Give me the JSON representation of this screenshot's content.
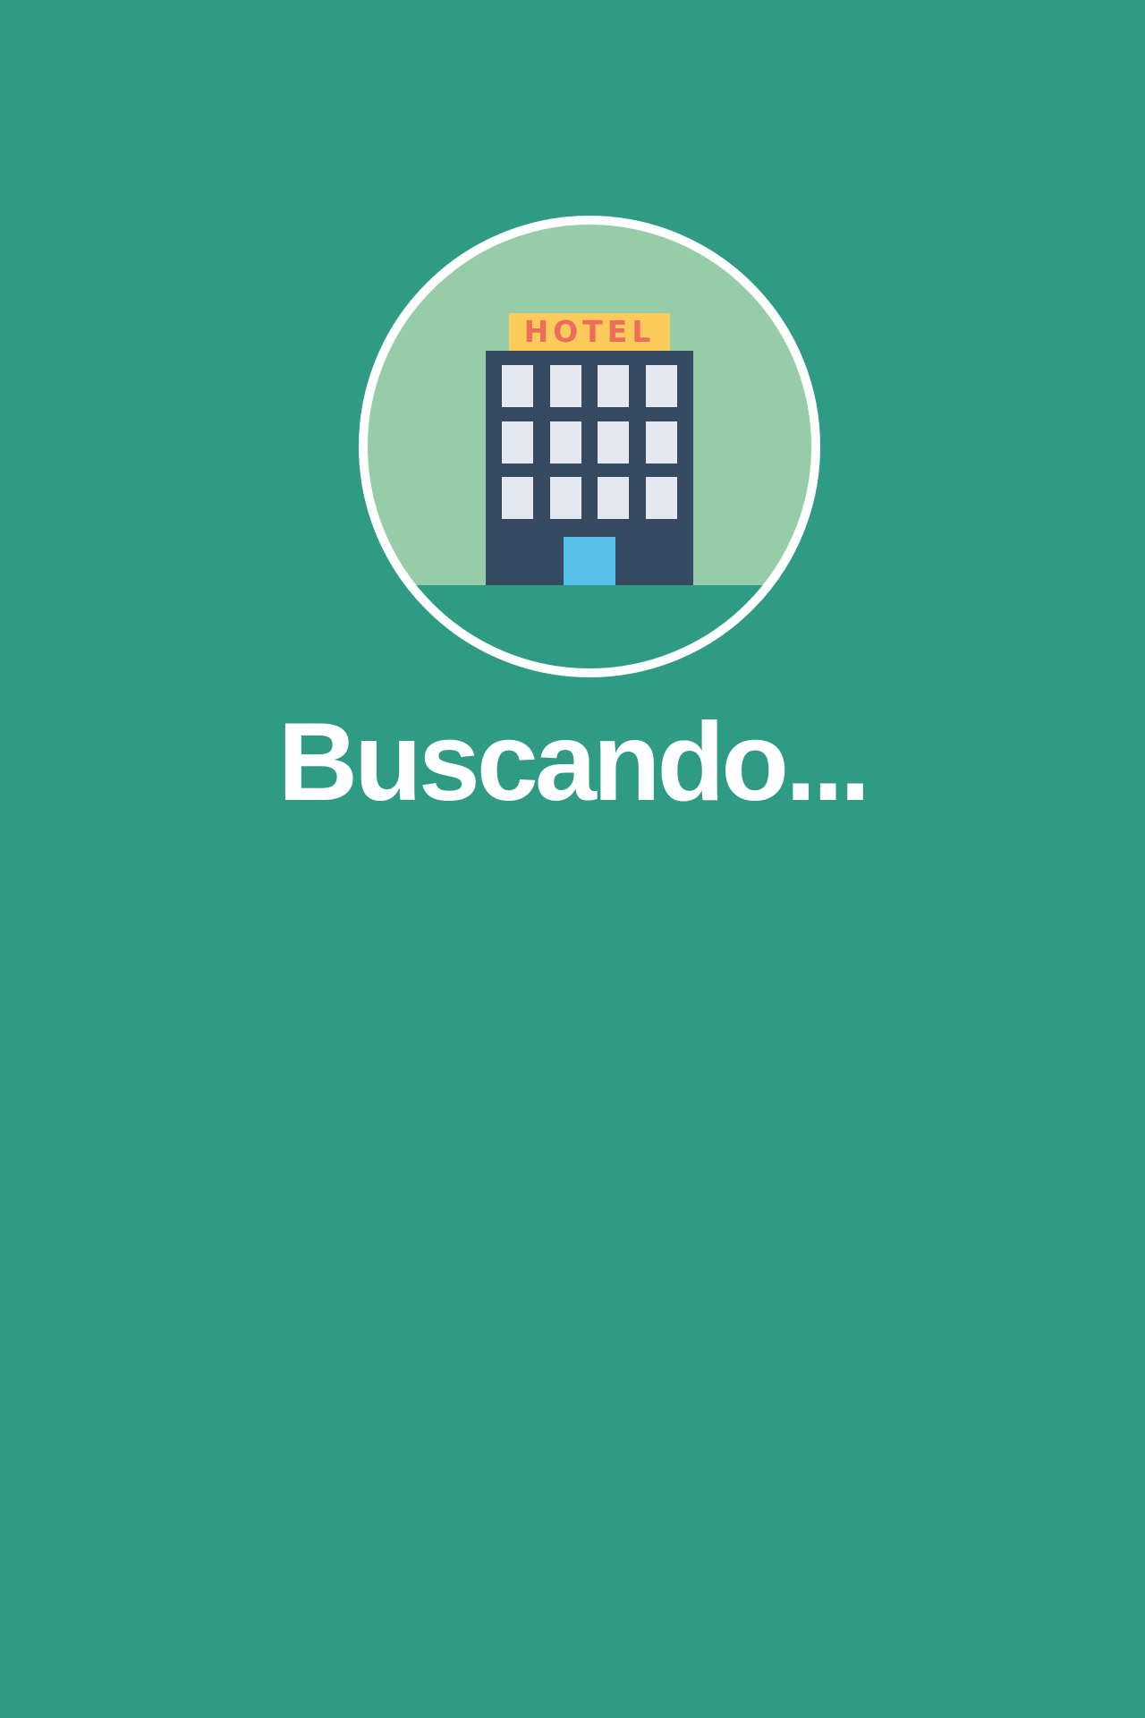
{
  "screen": {
    "background_color": "#309b84",
    "status_text": "Buscando..."
  },
  "illustration": {
    "icon": "hotel-building-icon",
    "sign_text": "HOTEL",
    "colors": {
      "sky": "#97cca8",
      "ground": "#309b84",
      "ring": "#ffffff",
      "building": "#364b61",
      "windows": "#e5e7f1",
      "door": "#56bfea",
      "sign_background": "#fdca5c",
      "sign_text": "#ee6c5b"
    }
  }
}
